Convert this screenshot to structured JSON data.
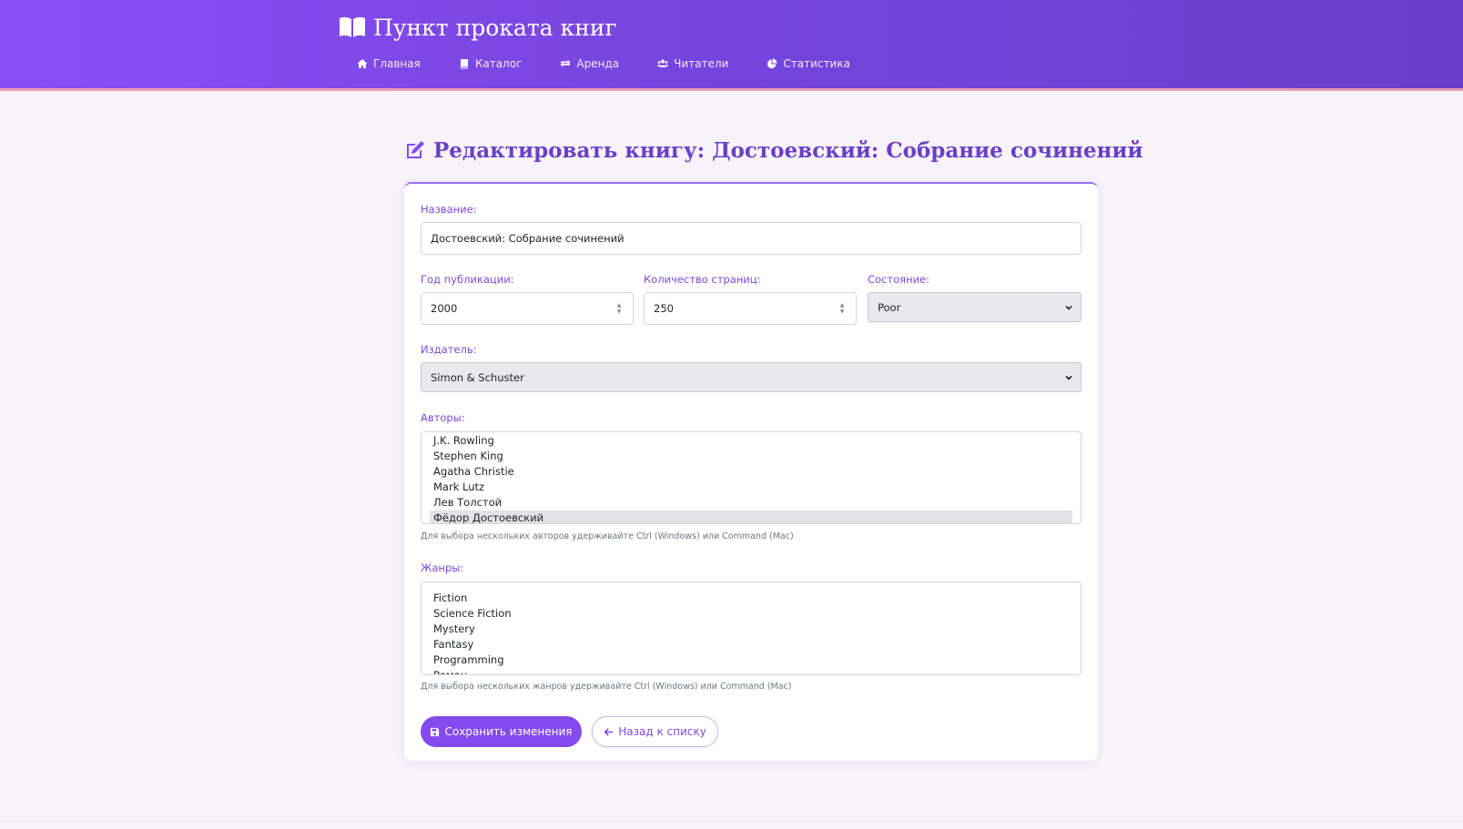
{
  "header": {
    "brand": "Пункт проката книг",
    "nav": [
      {
        "label": "Главная",
        "icon": "home-icon"
      },
      {
        "label": "Каталог",
        "icon": "book-icon"
      },
      {
        "label": "Аренда",
        "icon": "exchange-icon"
      },
      {
        "label": "Читатели",
        "icon": "users-icon"
      },
      {
        "label": "Статистика",
        "icon": "pie-chart-icon"
      }
    ]
  },
  "page": {
    "title": "Редактировать книгу: Достоевский: Собрание сочинений",
    "title_icon": "edit-icon"
  },
  "form": {
    "title_label": "Название:",
    "title_value": "Достоевский: Собрание сочинений",
    "year_label": "Год публикации:",
    "year_value": "2000",
    "pages_label": "Количество страниц:",
    "pages_value": "250",
    "condition_label": "Состояние:",
    "condition_value": "Poor",
    "publisher_label": "Издатель:",
    "publisher_value": "Simon & Schuster",
    "authors_label": "Авторы:",
    "authors": [
      {
        "name": "J.K. Rowling",
        "selected": false
      },
      {
        "name": "Stephen King",
        "selected": false
      },
      {
        "name": "Agatha Christie",
        "selected": false
      },
      {
        "name": "Mark Lutz",
        "selected": false
      },
      {
        "name": "Лев Толстой",
        "selected": false
      },
      {
        "name": "Фёдор Достоевский",
        "selected": true
      }
    ],
    "authors_help": "Для выбора нескольких авторов удерживайте Ctrl (Windows) или Command (Mac)",
    "genres_label": "Жанры:",
    "genres": [
      {
        "name": "Fiction",
        "selected": false
      },
      {
        "name": "Science Fiction",
        "selected": false
      },
      {
        "name": "Mystery",
        "selected": false
      },
      {
        "name": "Fantasy",
        "selected": false
      },
      {
        "name": "Programming",
        "selected": false
      },
      {
        "name": "Роман",
        "selected": false
      }
    ],
    "genres_help": "Для выбора нескольких жанров удерживайте Ctrl (Windows) или Command (Mac)",
    "save_label": "Сохранить изменения",
    "save_icon": "save-icon",
    "back_label": "Назад к списку",
    "back_icon": "arrow-left-icon"
  },
  "colors": {
    "accent": "#8549ec",
    "header_start": "#8b4ef3",
    "header_end": "#6a3ec9",
    "label": "#7b48d8",
    "background": "#f6f3fb"
  }
}
